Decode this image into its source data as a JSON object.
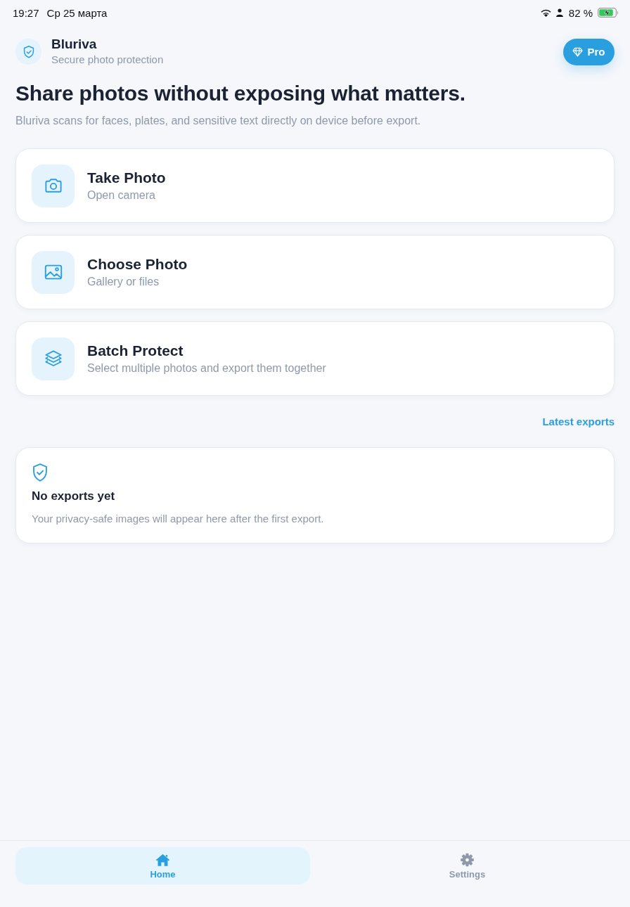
{
  "status_bar": {
    "time": "19:27",
    "date": "Ср 25 марта",
    "battery": "82 %"
  },
  "header": {
    "app_name": "Bluriva",
    "tagline": "Secure photo protection",
    "pro_button": "Pro"
  },
  "hero": {
    "title": "Share photos without exposing what matters.",
    "subtitle": "Bluriva scans for faces, plates, and sensitive text directly on device before export."
  },
  "actions": [
    {
      "kind": "camera",
      "title": "Take Photo",
      "subtitle": "Open camera"
    },
    {
      "kind": "image",
      "title": "Choose Photo",
      "subtitle": "Gallery or files"
    },
    {
      "kind": "layers",
      "title": "Batch Protect",
      "subtitle": "Select multiple photos and export them together"
    }
  ],
  "latest_exports": {
    "link": "Latest exports",
    "empty_title": "No exports yet",
    "empty_text": "Your privacy-safe images will appear here after the first export."
  },
  "tab_bar": [
    {
      "kind": "home",
      "label": "Home",
      "selected": true
    },
    {
      "kind": "settings",
      "label": "Settings",
      "selected": false
    }
  ]
}
